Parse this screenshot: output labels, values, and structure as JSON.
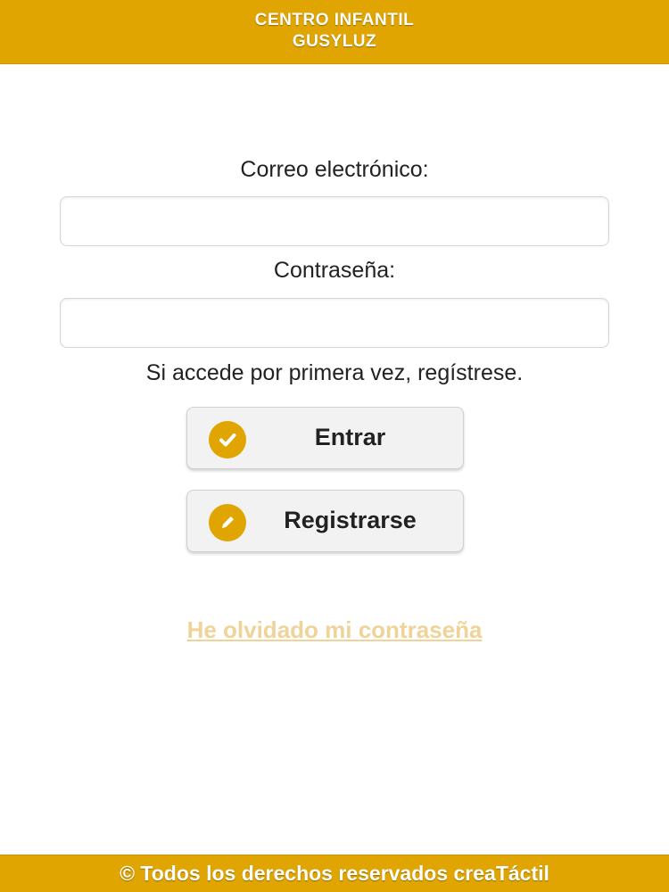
{
  "header": {
    "title_line1": "CENTRO INFANTIL",
    "title_line2": "GUSYLUZ"
  },
  "form": {
    "email_label": "Correo electrónico:",
    "email_value": "",
    "password_label": "Contraseña:",
    "password_value": "",
    "first_access_note": "Si accede por primera vez, regístrese."
  },
  "buttons": {
    "login_label": "Entrar",
    "login_icon": "check-icon",
    "register_label": "Registrarse",
    "register_icon": "pencil-icon"
  },
  "links": {
    "forgot_password": "He olvidado mi contraseña"
  },
  "footer": {
    "copyright": "© Todos los derechos reservados creaTáctil"
  },
  "colors": {
    "brand": "#E0A500",
    "link": "#EFD398",
    "button_bg": "#F2F2F2"
  }
}
